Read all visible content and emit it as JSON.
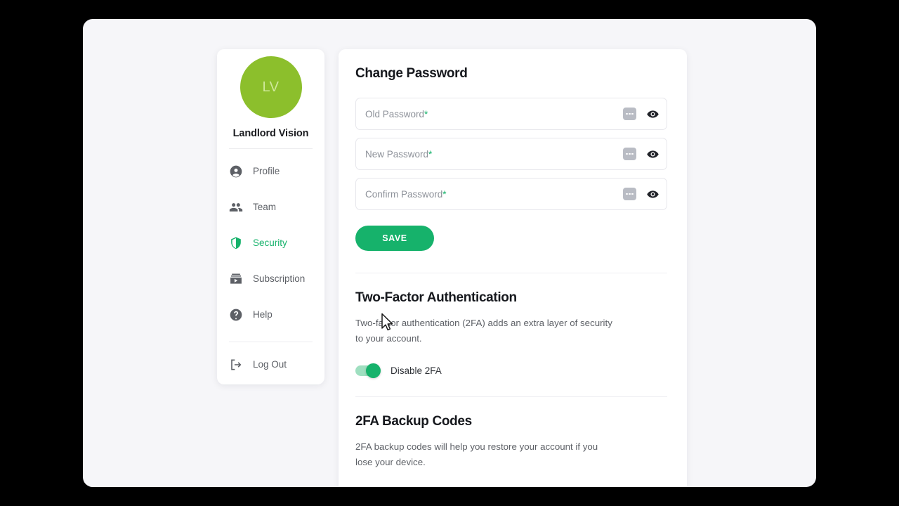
{
  "sidebar": {
    "avatar_initials": "LV",
    "org_name": "Landlord Vision",
    "items": [
      {
        "label": "Profile",
        "icon": "account-circle-icon",
        "active": false
      },
      {
        "label": "Team",
        "icon": "people-icon",
        "active": false
      },
      {
        "label": "Security",
        "icon": "shield-icon",
        "active": true
      },
      {
        "label": "Subscription",
        "icon": "subscriptions-icon",
        "active": false
      },
      {
        "label": "Help",
        "icon": "help-circle-icon",
        "active": false
      },
      {
        "label": "Log Out",
        "icon": "logout-icon",
        "active": false
      }
    ]
  },
  "main": {
    "change_password": {
      "title": "Change Password",
      "fields": [
        {
          "label": "Old Password",
          "required_mark": "*",
          "value": "",
          "placeholder": "Old Password *"
        },
        {
          "label": "New Password",
          "required_mark": "*",
          "value": "",
          "placeholder": "New Password *"
        },
        {
          "label": "Confirm Password",
          "required_mark": "*",
          "value": "",
          "placeholder": "Confirm Password *"
        }
      ],
      "save_label": "SAVE"
    },
    "two_factor": {
      "title": "Two-Factor Authentication",
      "description": "Two-factor authentication (2FA) adds an extra layer of security to your account.",
      "toggle_label": "Disable 2FA",
      "toggle_state": "on"
    },
    "backup_codes": {
      "title": "2FA Backup Codes",
      "description": "2FA backup codes will help you restore your account if you lose your device."
    }
  },
  "colors": {
    "brand_green": "#16b26b",
    "avatar_green": "#8cbf2c",
    "toggle_track": "#9fdfc0",
    "page_bg": "#f6f6f9"
  }
}
